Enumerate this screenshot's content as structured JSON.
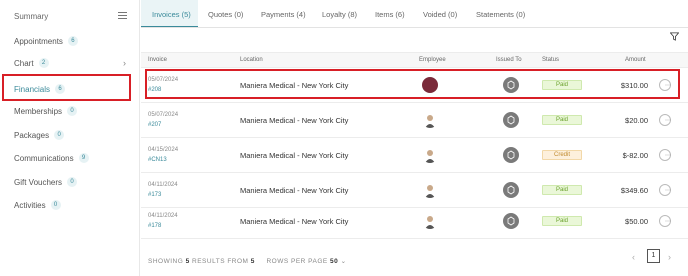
{
  "sidebar": {
    "header": "Summary",
    "items": [
      {
        "label": "Appointments",
        "badge": "6"
      },
      {
        "label": "Chart",
        "badge": "2"
      },
      {
        "label": "Financials",
        "badge": "6"
      },
      {
        "label": "Memberships",
        "badge": "0"
      },
      {
        "label": "Packages",
        "badge": "0"
      },
      {
        "label": "Communications",
        "badge": "9"
      },
      {
        "label": "Gift Vouchers",
        "badge": "0"
      },
      {
        "label": "Activities",
        "badge": "0"
      }
    ]
  },
  "tabs": [
    {
      "label": "Invoices (5)"
    },
    {
      "label": "Quotes (0)"
    },
    {
      "label": "Payments (4)"
    },
    {
      "label": "Loyalty (8)"
    },
    {
      "label": "Items (6)"
    },
    {
      "label": "Voided (0)"
    },
    {
      "label": "Statements (0)"
    }
  ],
  "table": {
    "headers": [
      "Invoice",
      "Location",
      "Employee",
      "Issued To",
      "Status",
      "Amount"
    ],
    "rows": [
      {
        "date": "05/07/2024",
        "invoice": "#208",
        "location": "Maniera Medical - New York City",
        "status": "Paid",
        "amount": "$310.00"
      },
      {
        "date": "05/07/2024",
        "invoice": "#207",
        "location": "Maniera Medical - New York City",
        "status": "Paid",
        "amount": "$20.00"
      },
      {
        "date": "04/15/2024",
        "invoice": "#CN13",
        "location": "Maniera Medical - New York City",
        "status": "Credit",
        "amount": "$-82.00"
      },
      {
        "date": "04/11/2024",
        "invoice": "#173",
        "location": "Maniera Medical - New York City",
        "status": "Paid",
        "amount": "$349.60"
      },
      {
        "date": "04/11/2024",
        "invoice": "#178",
        "location": "Maniera Medical - New York City",
        "status": "Paid",
        "amount": "$50.00"
      }
    ]
  },
  "footer": {
    "showing_label": "SHOWING",
    "showing_count": "5",
    "results_from_label": "RESULTS FROM",
    "results_total": "5",
    "rows_per_page_label": "ROWS PER PAGE",
    "rows_per_page": "50",
    "current_page": "1"
  },
  "colors": {
    "accent": "#3a8a9a",
    "highlight": "#d81f26",
    "paid": "#6aa12c",
    "credit": "#c08a2e"
  }
}
